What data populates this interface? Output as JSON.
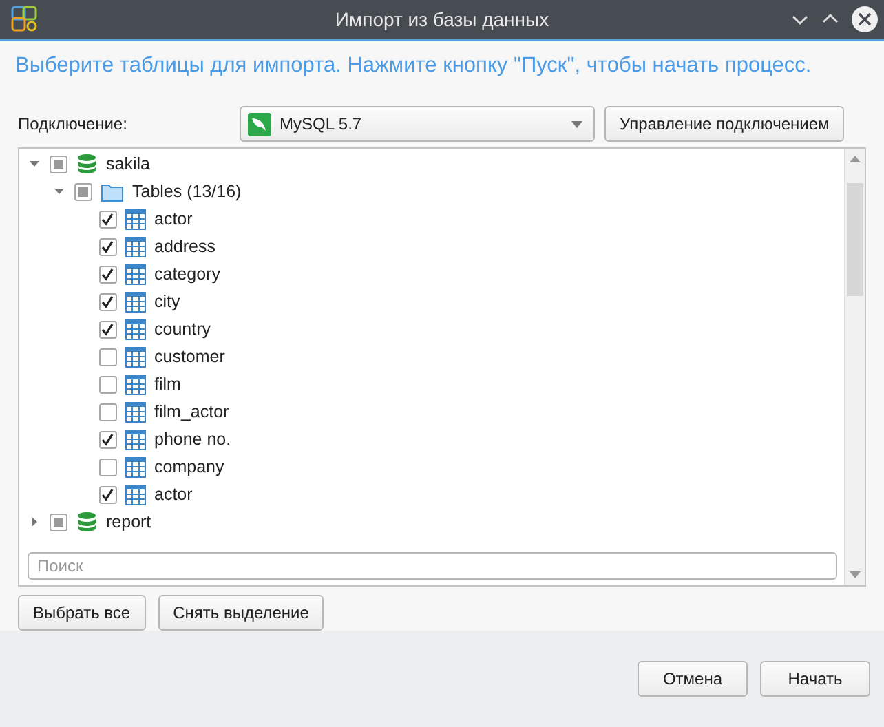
{
  "window": {
    "title": "Импорт из базы данных"
  },
  "instruction": "Выберите таблицы для импорта. Нажмите кнопку \"Пуск\", чтобы начать процесс.",
  "connection": {
    "label": "Подключение:",
    "value": "MySQL 5.7",
    "manage_button": "Управление подключением"
  },
  "tree": [
    {
      "kind": "database",
      "label": "sakila",
      "expanded": true,
      "partial": true,
      "children": [
        {
          "kind": "folder",
          "label": "Tables (13/16)",
          "expanded": true,
          "partial": true,
          "children": [
            {
              "kind": "table",
              "label": "actor",
              "checked": true,
              "partial": false
            },
            {
              "kind": "table",
              "label": "address",
              "checked": true,
              "partial": false
            },
            {
              "kind": "table",
              "label": "category",
              "checked": true,
              "partial": false
            },
            {
              "kind": "table",
              "label": "city",
              "checked": true,
              "partial": false
            },
            {
              "kind": "table",
              "label": "country",
              "checked": true,
              "partial": false
            },
            {
              "kind": "table",
              "label": "customer",
              "checked": false,
              "partial": false
            },
            {
              "kind": "table",
              "label": "film",
              "checked": false,
              "partial": false
            },
            {
              "kind": "table",
              "label": "film_actor",
              "checked": false,
              "partial": false
            },
            {
              "kind": "table",
              "label": "phone no.",
              "checked": true,
              "partial": false
            },
            {
              "kind": "table",
              "label": "company",
              "checked": false,
              "partial": false
            },
            {
              "kind": "table",
              "label": "actor",
              "checked": true,
              "partial": false
            }
          ]
        }
      ]
    },
    {
      "kind": "database",
      "label": "report",
      "expanded": false,
      "partial": true
    }
  ],
  "search": {
    "placeholder": "Поиск"
  },
  "select_buttons": [
    "Выбрать все",
    "Снять выделение"
  ],
  "footer_buttons": [
    "Отмена",
    "Начать"
  ]
}
